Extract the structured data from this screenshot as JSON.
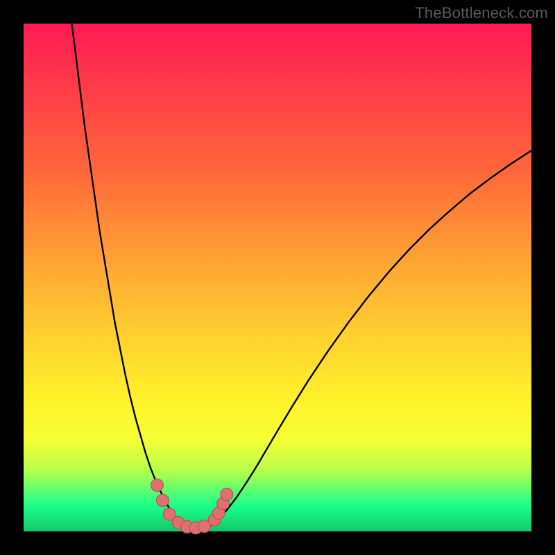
{
  "watermark": "TheBottleneck.com",
  "colors": {
    "frame": "#000000",
    "gradient_top": "#ff1a54",
    "gradient_mid": "#fff22a",
    "gradient_bottom": "#16e47a",
    "curve": "#000000",
    "marker_fill": "#e07070",
    "marker_stroke": "#b84a4a"
  },
  "chart_data": {
    "type": "line",
    "title": "",
    "xlabel": "",
    "ylabel": "",
    "xlim": [
      0,
      100
    ],
    "ylim": [
      0,
      100
    ],
    "grid": false,
    "series": [
      {
        "name": "curve",
        "x": [
          9.5,
          10,
          11,
          12,
          13,
          14,
          15,
          16,
          17,
          18,
          19,
          20,
          21,
          22,
          23,
          24,
          25,
          26,
          27,
          28,
          29,
          30,
          31,
          32,
          33,
          34,
          35,
          36,
          38,
          40,
          42,
          44,
          46,
          48,
          50,
          53,
          56,
          60,
          64,
          68,
          72,
          76,
          80,
          84,
          88,
          92,
          96,
          100
        ],
        "y": [
          100,
          96,
          88,
          80,
          73,
          66,
          59,
          53,
          47,
          41,
          36,
          31,
          26.5,
          22.5,
          19,
          15.5,
          12.5,
          10,
          7.8,
          5.8,
          4.0,
          2.5,
          1.4,
          0.7,
          0.3,
          0.2,
          0.3,
          0.7,
          2.0,
          4.2,
          6.8,
          9.8,
          13.0,
          16.4,
          19.8,
          24.8,
          29.6,
          35.6,
          41.2,
          46.4,
          51.2,
          55.6,
          59.6,
          63.2,
          66.6,
          69.6,
          72.4,
          75.0
        ]
      }
    ],
    "markers": [
      {
        "x": 26.3,
        "y": 9.1
      },
      {
        "x": 27.4,
        "y": 6.1
      },
      {
        "x": 28.7,
        "y": 3.4
      },
      {
        "x": 30.5,
        "y": 1.7
      },
      {
        "x": 32.2,
        "y": 0.9
      },
      {
        "x": 33.9,
        "y": 0.7
      },
      {
        "x": 35.6,
        "y": 1.0
      },
      {
        "x": 37.6,
        "y": 2.3
      },
      {
        "x": 38.4,
        "y": 3.6
      },
      {
        "x": 39.3,
        "y": 5.5
      },
      {
        "x": 40.0,
        "y": 7.3
      }
    ],
    "annotations": []
  }
}
